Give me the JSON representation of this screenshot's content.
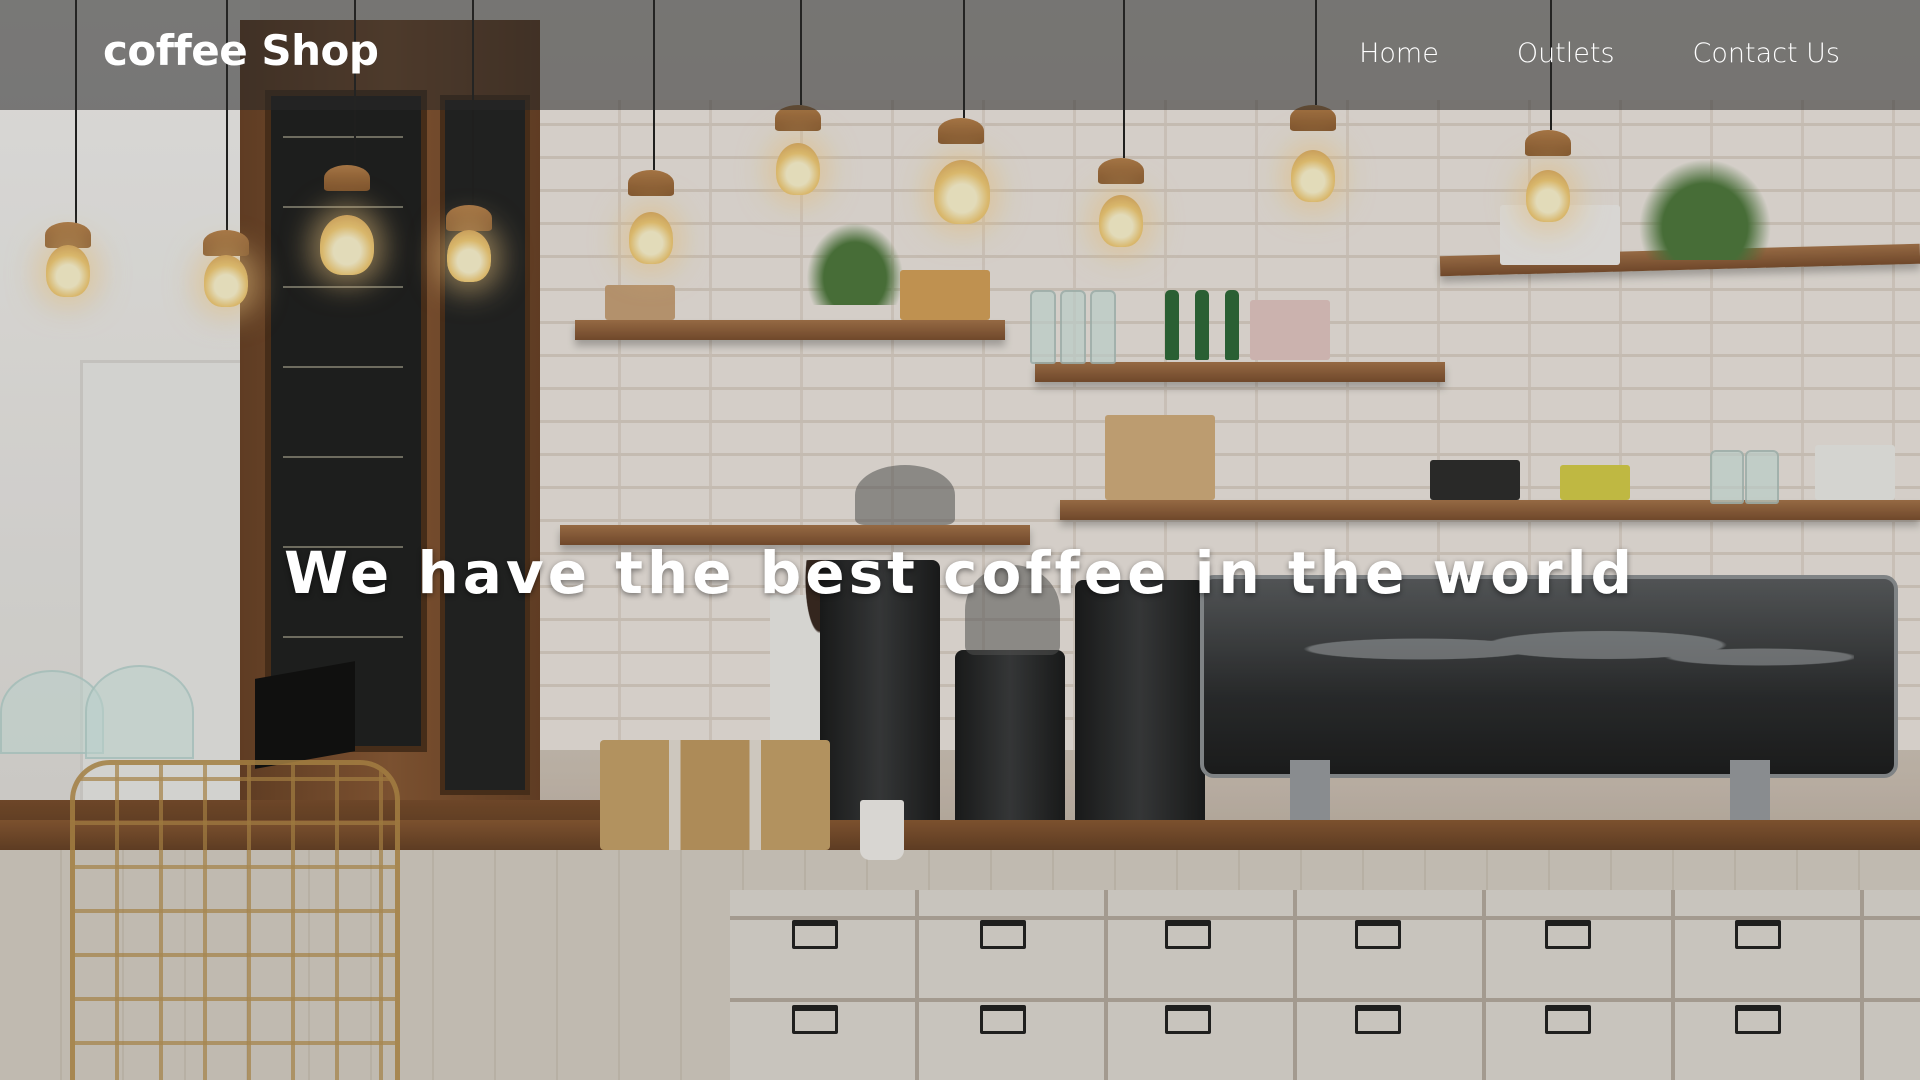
{
  "navbar": {
    "brand": "coffee Shop",
    "links": [
      {
        "label": "Home"
      },
      {
        "label": "Outlets"
      },
      {
        "label": "Contact Us"
      }
    ]
  },
  "hero": {
    "headline": "We have the best coffee in the world",
    "background_image": "cafe-interior-photo"
  },
  "colors": {
    "navbar_background": "#282828",
    "text": "#ffffff"
  }
}
